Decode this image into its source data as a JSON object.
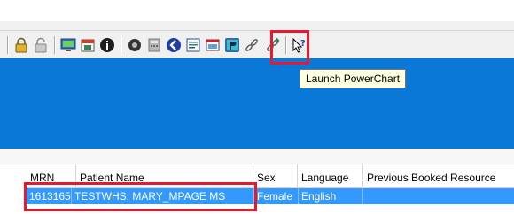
{
  "toolbar": {
    "icons": [
      "padlock-icon",
      "unlock-icon",
      "monitor-icon",
      "calendar-icon",
      "info-icon",
      "pill-icon",
      "calculator-icon",
      "back-arrow-icon",
      "notepad-icon",
      "schedule-icon",
      "powerchart-icon",
      "link-icon",
      "link-add-icon",
      "help-icon"
    ],
    "tooltip": "Launch PowerChart"
  },
  "grid": {
    "columns": [
      "MRN",
      "Patient Name",
      "Sex",
      "Language",
      "Previous Booked Resource"
    ],
    "rows": [
      {
        "mrn": "1613165",
        "patient_name": "TESTWHS, MARY_MPAGE  MS",
        "sex": "Female",
        "language": "English",
        "previous_booked_resource": ""
      }
    ]
  },
  "colors": {
    "blue_panel": "#0a78d7",
    "selected_row": "#3399ff",
    "highlight_box": "#e8192c",
    "tooltip_bg": "#ffffe1"
  }
}
